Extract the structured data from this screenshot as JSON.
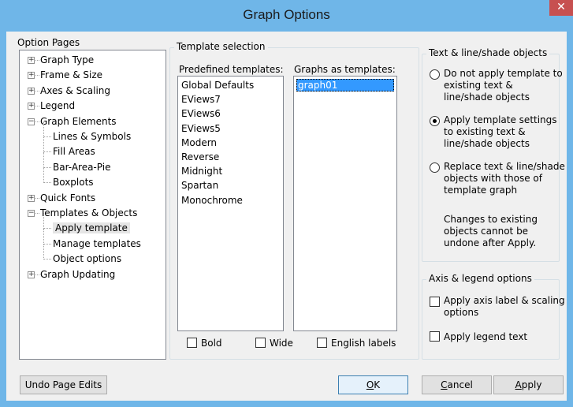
{
  "window": {
    "title": "Graph Options",
    "close_glyph": "✕"
  },
  "option_pages": {
    "label": "Option Pages",
    "tree": [
      {
        "label": "Graph Type",
        "level": 0,
        "expander": "+"
      },
      {
        "label": "Frame & Size",
        "level": 0,
        "expander": "+"
      },
      {
        "label": "Axes & Scaling",
        "level": 0,
        "expander": "+"
      },
      {
        "label": "Legend",
        "level": 0,
        "expander": "+"
      },
      {
        "label": "Graph Elements",
        "level": 0,
        "expander": "−"
      },
      {
        "label": "Lines & Symbols",
        "level": 1
      },
      {
        "label": "Fill Areas",
        "level": 1
      },
      {
        "label": "Bar-Area-Pie",
        "level": 1
      },
      {
        "label": "Boxplots",
        "level": 1
      },
      {
        "label": "Quick Fonts",
        "level": 0,
        "expander": "+"
      },
      {
        "label": "Templates & Objects",
        "level": 0,
        "expander": "−"
      },
      {
        "label": "Apply template",
        "level": 1,
        "selected": true
      },
      {
        "label": "Manage templates",
        "level": 1
      },
      {
        "label": "Object options",
        "level": 1
      },
      {
        "label": "Graph Updating",
        "level": 0,
        "expander": "+"
      }
    ]
  },
  "template_selection": {
    "title": "Template selection",
    "predefined_label": "Predefined templates:",
    "predefined": [
      "Global Defaults",
      "EViews7",
      "EViews6",
      "EViews5",
      "Modern",
      "Reverse",
      "Midnight",
      "Spartan",
      "Monochrome"
    ],
    "graphs_label": "Graphs as templates:",
    "graphs": [
      "graph01"
    ],
    "bold_label": "Bold",
    "wide_label": "Wide",
    "english_label": "English labels"
  },
  "text_objects": {
    "title": "Text & line/shade objects",
    "options": [
      {
        "lines": [
          "Do not apply template to",
          "existing text &",
          "line/shade objects"
        ],
        "checked": false
      },
      {
        "lines": [
          "Apply template settings",
          "to existing text &",
          "line/shade objects"
        ],
        "checked": true
      },
      {
        "lines": [
          "Replace text & line/shade",
          "objects with those of",
          "template graph"
        ],
        "checked": false
      }
    ],
    "note": [
      "Changes to existing",
      "objects cannot be",
      "undone after Apply."
    ]
  },
  "axis_legend": {
    "title": "Axis & legend options",
    "axis_label_lines": [
      "Apply axis label & scaling",
      "options"
    ],
    "legend_label": "Apply legend text"
  },
  "buttons": {
    "undo": "Undo Page Edits",
    "ok_mnemonic": "O",
    "ok_rest": "K",
    "cancel_mnemonic": "C",
    "cancel_rest": "ancel",
    "apply_mnemonic": "A",
    "apply_rest": "pply"
  }
}
